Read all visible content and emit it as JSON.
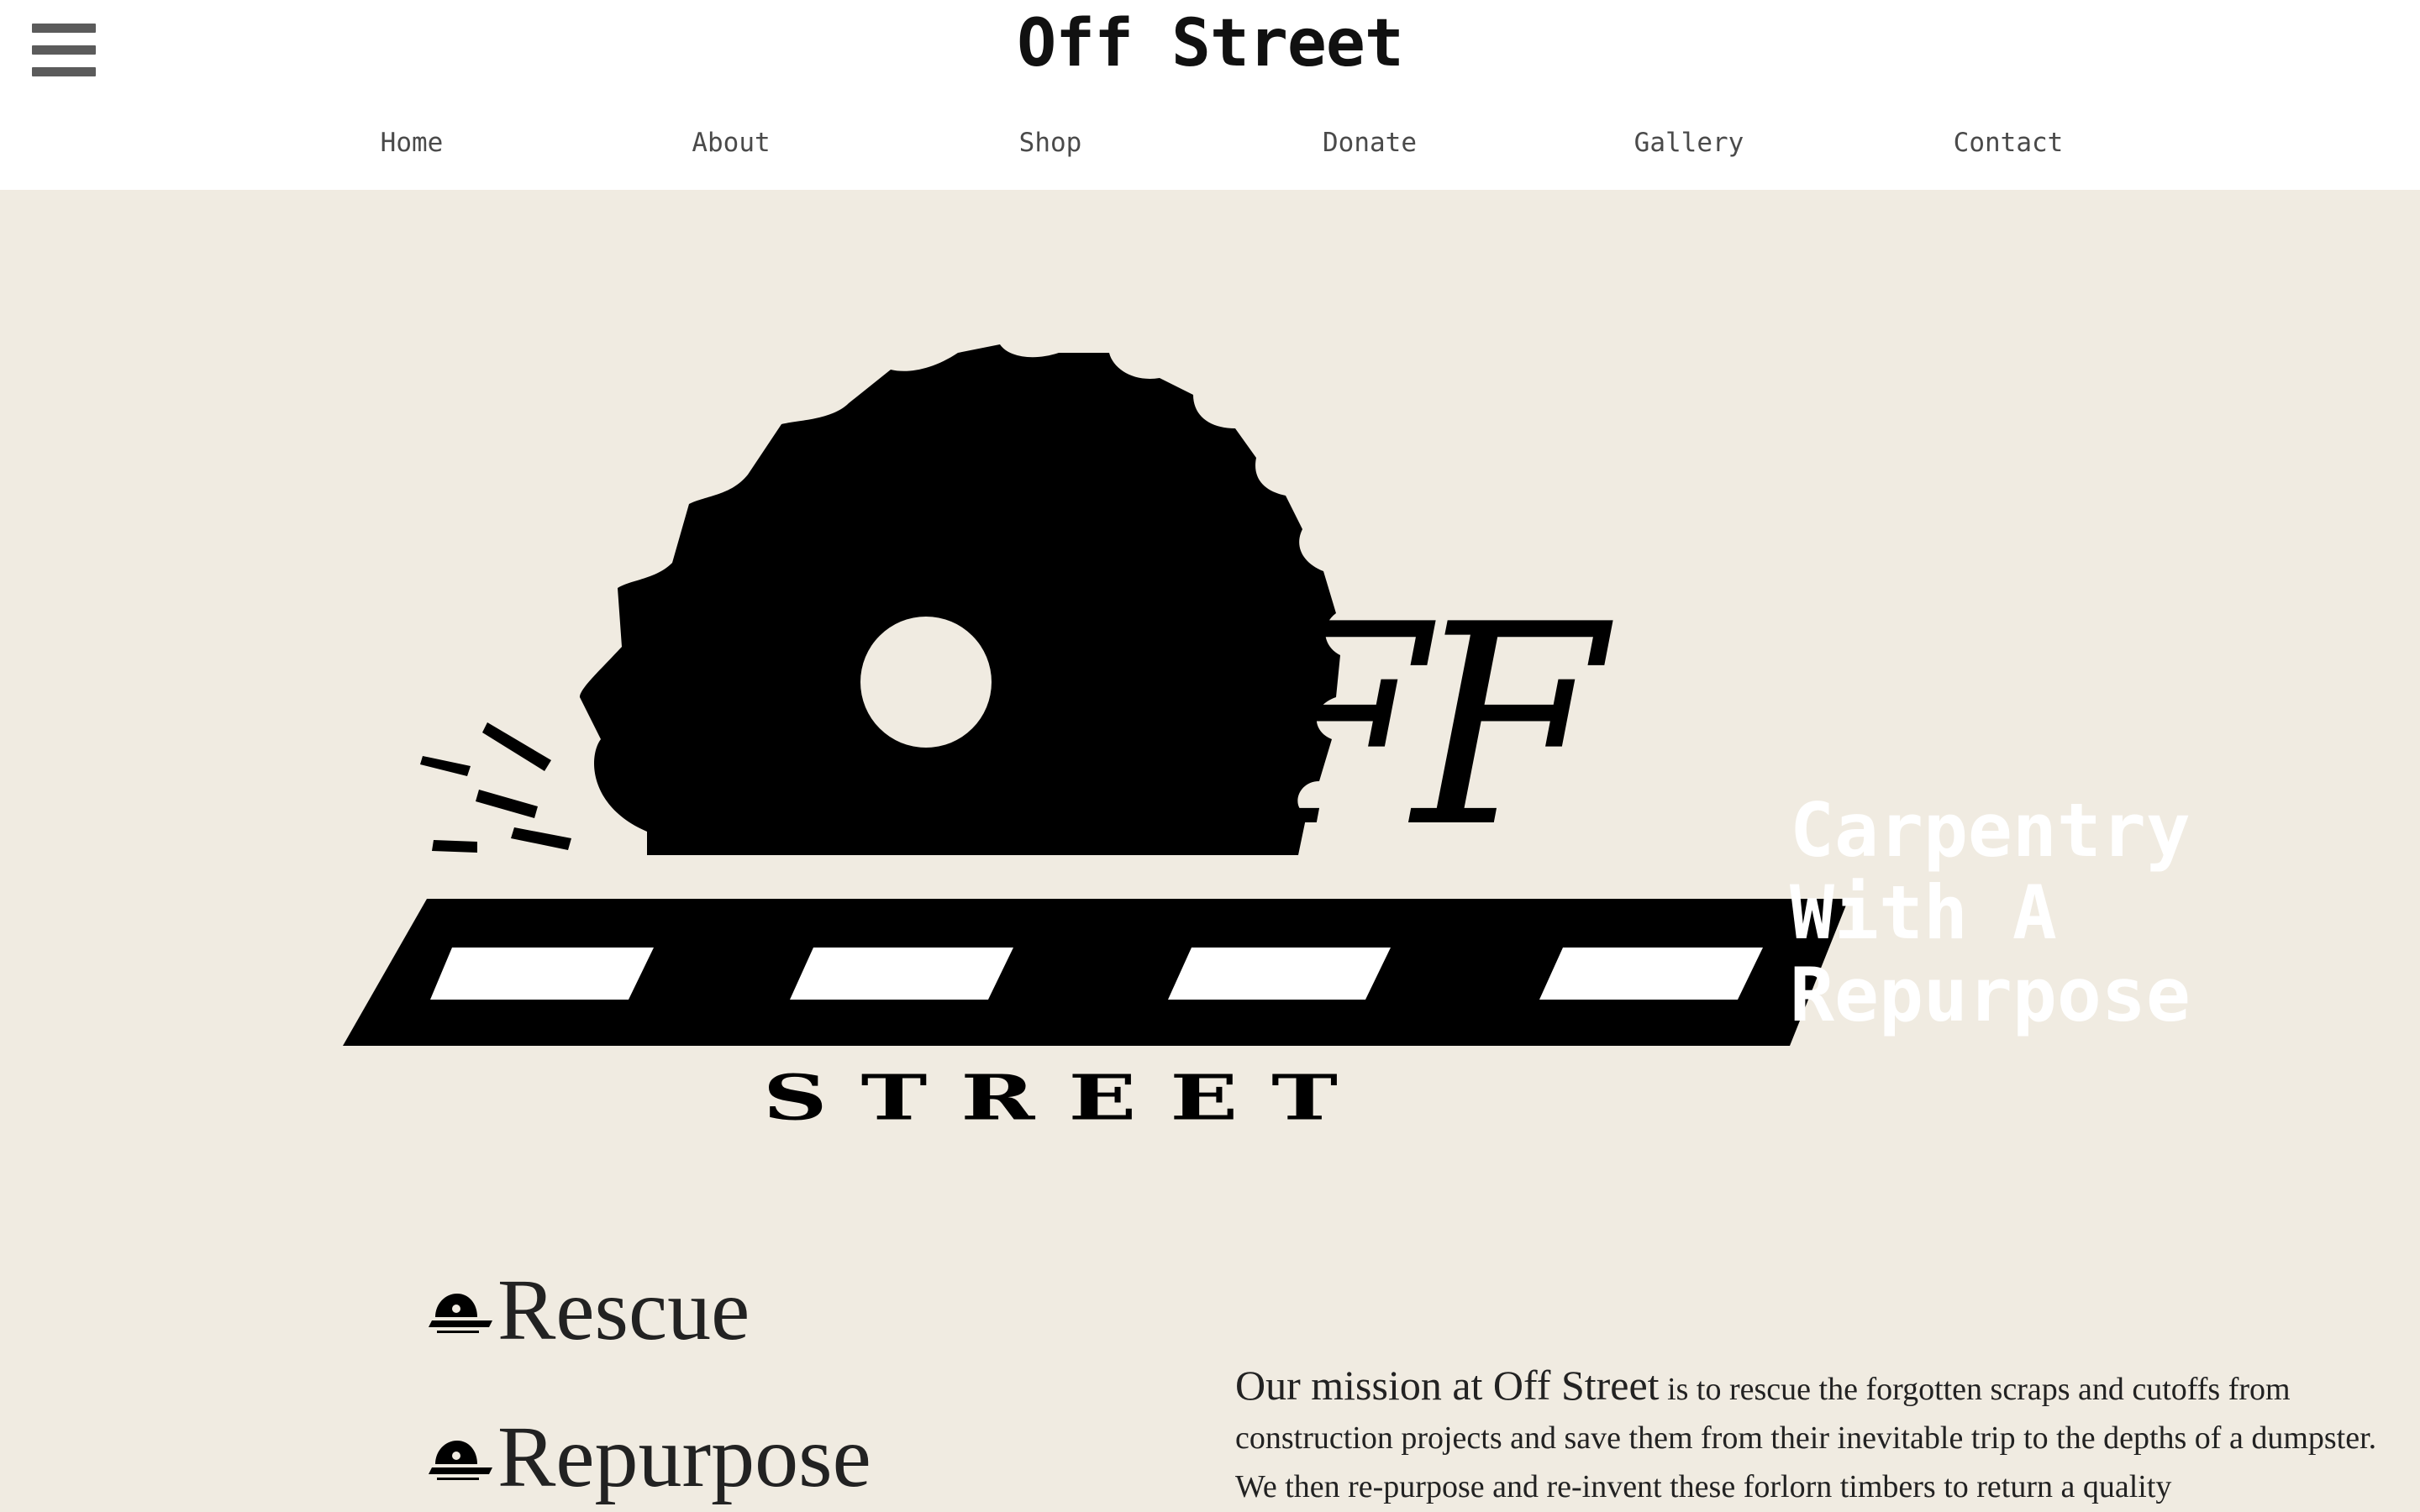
{
  "header": {
    "site_title": "Off Street",
    "nav": [
      {
        "label": "Home"
      },
      {
        "label": "About"
      },
      {
        "label": "Shop"
      },
      {
        "label": "Donate"
      },
      {
        "label": "Gallery"
      },
      {
        "label": "Contact"
      }
    ]
  },
  "hero": {
    "logo_ff": "FF",
    "logo_street": "STREET",
    "tagline": [
      "Carpentry",
      "With A",
      "Repurpose"
    ]
  },
  "pillars": [
    {
      "label": "Rescue"
    },
    {
      "label": "Repurpose"
    }
  ],
  "mission": {
    "lead": "Our mission at Off Street",
    "body": " is to rescue the forgotten scraps and cutoffs from construction projects and save them from their inevitable trip to the depths of a dumpster. We then re-purpose and re-invent these forlorn timbers to return a quality"
  },
  "colors": {
    "page_background": "#f0ebe1",
    "header_background": "#ffffff",
    "logo": "#000000",
    "tagline": "#ffffff",
    "text": "#222222",
    "nav_text": "#4a4a4a"
  },
  "icons": [
    "hamburger-menu-icon",
    "saw-blade-logo",
    "saw-blade-mini-icon"
  ]
}
